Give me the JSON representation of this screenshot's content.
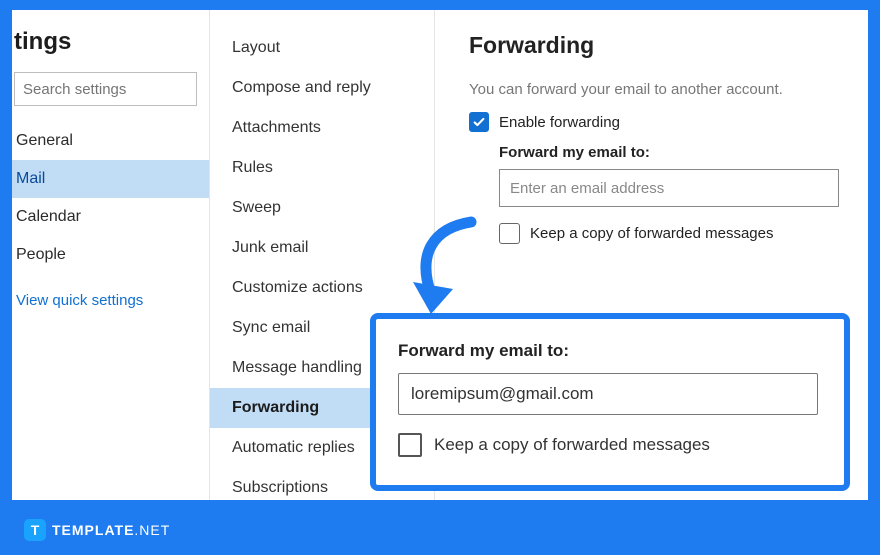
{
  "settings_title": "tings",
  "search_placeholder": "Search settings",
  "nav": {
    "items": [
      "General",
      "Mail",
      "Calendar",
      "People"
    ],
    "active_index": 1,
    "quick_link": "View quick settings"
  },
  "mid": {
    "items": [
      "Layout",
      "Compose and reply",
      "Attachments",
      "Rules",
      "Sweep",
      "Junk email",
      "Customize actions",
      "Sync email",
      "Message handling",
      "Forwarding",
      "Automatic replies",
      "Subscriptions"
    ],
    "active_index": 9
  },
  "main": {
    "title": "Forwarding",
    "description": "You can forward your email to another account.",
    "enable_label": "Enable forwarding",
    "forward_to_label": "Forward my email to:",
    "email_placeholder": "Enter an email address",
    "keep_copy_label": "Keep a copy of forwarded messages"
  },
  "callout": {
    "forward_to_label": "Forward my email to:",
    "email_value": "loremipsum@gmail.com",
    "keep_copy_label": "Keep a copy of forwarded messages"
  },
  "watermark": {
    "icon_letter": "T",
    "brand": "TEMPLATE",
    "suffix": ".NET"
  }
}
